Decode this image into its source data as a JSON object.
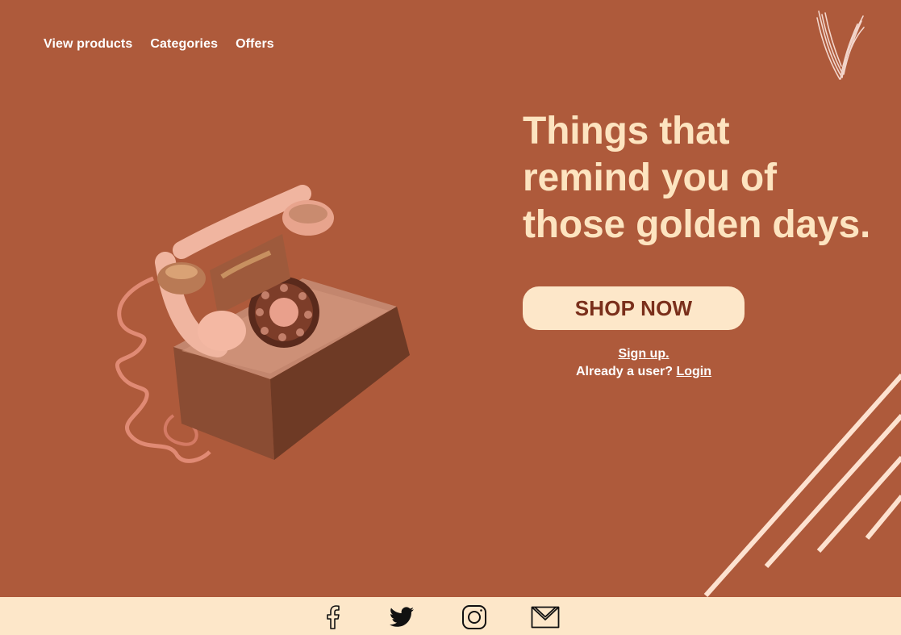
{
  "nav": {
    "items": [
      {
        "label": "View products"
      },
      {
        "label": "Categories"
      },
      {
        "label": "Offers"
      }
    ]
  },
  "hero": {
    "headline_lines": [
      "Things that",
      "remind you of",
      "those golden days."
    ],
    "cta_label": "SHOP NOW"
  },
  "auth": {
    "signup_label": "Sign up.",
    "already_user_text": "Already a user?",
    "login_label": "Login"
  },
  "footer": {
    "social": [
      {
        "icon": "facebook-icon"
      },
      {
        "icon": "twitter-icon"
      },
      {
        "icon": "instagram-icon"
      },
      {
        "icon": "mail-icon"
      }
    ]
  },
  "colors": {
    "background": "#ae5a3b",
    "headline": "#fde4c0",
    "button_bg": "#fde7c9",
    "button_text": "#7a2f1b",
    "footer_bg": "#fde7c9",
    "stripe": "#fde2d0"
  }
}
